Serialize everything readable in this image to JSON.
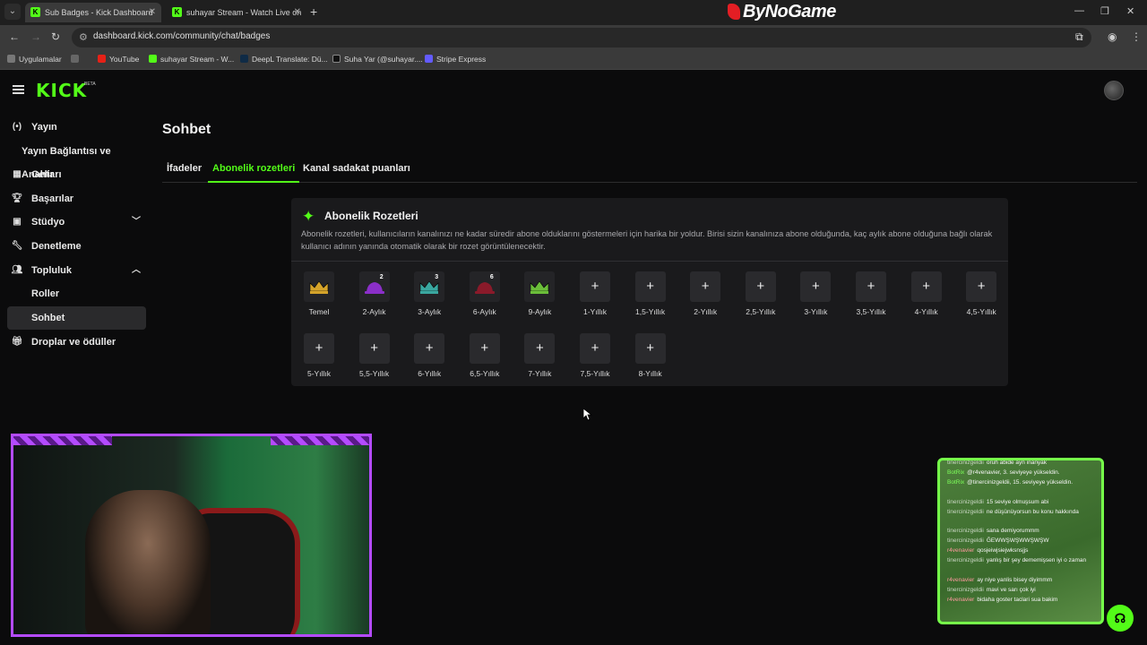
{
  "browser": {
    "tabs": [
      {
        "title": "Sub Badges - Kick Dashboard",
        "active": true
      },
      {
        "title": "suhayar Stream - Watch Live on",
        "active": false
      }
    ],
    "brand_overlay": "ByNoGame",
    "url": "dashboard.kick.com/community/chat/badges",
    "bookmarks": [
      "Uygulamalar",
      "YouTube",
      "suhayar Stream - W...",
      "DeepL Translate: Dü...",
      "Suha Yar (@suhayar....",
      "Stripe Express"
    ]
  },
  "header": {
    "logo": "KICK",
    "logo_badge": "BETA"
  },
  "sidebar": {
    "items": [
      {
        "label": "Yayın",
        "icon": "broadcast-icon"
      },
      {
        "label": "Yayın Bağlantısı ve Anahtarı",
        "icon": ""
      },
      {
        "label": "Gelir",
        "icon": "revenue-icon"
      },
      {
        "label": "Başarılar",
        "icon": "trophy-icon"
      },
      {
        "label": "Stüdyo",
        "icon": "studio-icon"
      },
      {
        "label": "Denetleme",
        "icon": "wrench-icon"
      },
      {
        "label": "Topluluk",
        "icon": "community-icon"
      },
      {
        "label": "Roller",
        "icon": ""
      },
      {
        "label": "Sohbet",
        "icon": ""
      },
      {
        "label": "Droplar ve ödüller",
        "icon": "gift-icon"
      }
    ]
  },
  "main": {
    "title": "Sohbet",
    "tabs": [
      "İfadeler",
      "Abonelik rozetleri",
      "Kanal sadakat puanları"
    ],
    "active_tab": "Abonelik rozetleri",
    "card": {
      "title": "Abonelik Rozetleri",
      "description": "Abonelik rozetleri, kullanıcıların kanalınızı ne kadar süredir abone olduklarını göstermeleri için harika bir yoldur. Birisi sizin kanalınıza abone olduğunda, kaç aylık abone olduğuna bağlı olarak kullanıcı adının yanında otomatik olarak bir rozet görüntülenecektir.",
      "badges_row1": [
        {
          "label": "Temel",
          "icon": "crown-icon",
          "filled": true,
          "color": "#d4a32a",
          "num": ""
        },
        {
          "label": "2-Aylık",
          "icon": "hat-icon",
          "filled": true,
          "color": "#8b2fc9",
          "num": "2"
        },
        {
          "label": "3-Aylık",
          "icon": "crown-icon",
          "filled": true,
          "color": "#3aa7a0",
          "num": "3"
        },
        {
          "label": "6-Aylık",
          "icon": "hat-icon",
          "filled": true,
          "color": "#8a1a2a",
          "num": "6"
        },
        {
          "label": "9-Aylık",
          "icon": "crown-icon",
          "filled": true,
          "color": "#6bbd3a",
          "num": ""
        },
        {
          "label": "1-Yıllık",
          "icon": "plus-icon",
          "filled": false,
          "num": ""
        },
        {
          "label": "1,5-Yıllık",
          "icon": "plus-icon",
          "filled": false,
          "num": ""
        },
        {
          "label": "2-Yıllık",
          "icon": "plus-icon",
          "filled": false,
          "num": ""
        },
        {
          "label": "2,5-Yıllık",
          "icon": "plus-icon",
          "filled": false,
          "num": ""
        },
        {
          "label": "3-Yıllık",
          "icon": "plus-icon",
          "filled": false,
          "num": ""
        },
        {
          "label": "3,5-Yıllık",
          "icon": "plus-icon",
          "filled": false,
          "num": ""
        },
        {
          "label": "4-Yıllık",
          "icon": "plus-icon",
          "filled": false,
          "num": ""
        },
        {
          "label": "4,5-Yıllık",
          "icon": "plus-icon",
          "filled": false,
          "num": ""
        }
      ],
      "badges_row2": [
        {
          "label": "5-Yıllık"
        },
        {
          "label": "5,5-Yıllık"
        },
        {
          "label": "6-Yıllık"
        },
        {
          "label": "6,5-Yıllık"
        },
        {
          "label": "7-Yıllık"
        },
        {
          "label": "7,5-Yıllık"
        },
        {
          "label": "8-Yıllık"
        }
      ]
    }
  },
  "chat_overlay": {
    "messages": [
      {
        "user": "tinercinizgeldii",
        "type": "u",
        "text": "oruh abide ayn inanyak"
      },
      {
        "user": "BotRix",
        "type": "bot",
        "text": "@r4venavier, 3. seviyeye yükseldin."
      },
      {
        "user": "BotRix",
        "type": "bot",
        "text": "@tinercinizgeldii, 15. seviyeye yükseldin."
      },
      {
        "user": "tinercinizgeldii",
        "type": "u",
        "text": "15 seviye olmuşsum abi"
      },
      {
        "user": "tinercinizgeldii",
        "type": "u",
        "text": "ne düşünüyorsun bu konu hakkında"
      },
      {
        "user": "tinercinizgeldii",
        "type": "u",
        "text": "sana demiyorummm"
      },
      {
        "user": "tinercinizgeldii",
        "type": "u",
        "text": "ĞEWWŞWŞWWŞWŞW"
      },
      {
        "user": "r4venavier",
        "type": "r4",
        "text": "qosjeiwjsiejwksnsjjs"
      },
      {
        "user": "tinercinizgeldii",
        "type": "u",
        "text": "yanlış bir şey dememişsen iyi o zaman"
      },
      {
        "user": "r4venavier",
        "type": "r4",
        "text": "ay niye yanlis bisey diyimmm"
      },
      {
        "user": "tinercinizgeldii",
        "type": "u",
        "text": "mavi ve sarı çok iyi"
      },
      {
        "user": "r4venavier",
        "type": "r4",
        "text": "bidaha goster taclari sua bakim"
      }
    ]
  }
}
